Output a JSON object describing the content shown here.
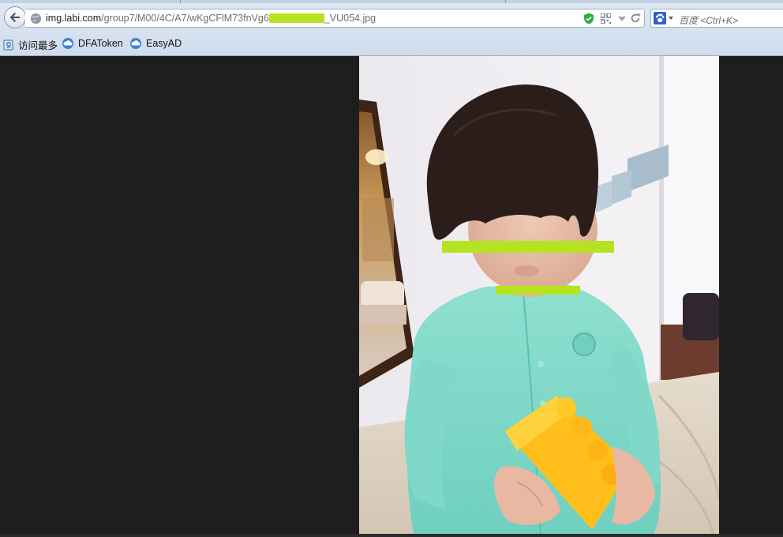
{
  "browser": {
    "url": {
      "host": "img.labi.com",
      "path_start": "/group7/M00/4C/A7/wKgCFlM73fnVg6",
      "path_end": "_VU054.jpg"
    },
    "search": {
      "engine_icon": "paw-icon",
      "placeholder": "百度 <Ctrl+K>"
    },
    "bookmarks": [
      {
        "label": "访问最多",
        "icon": "bookmark-folder-icon"
      },
      {
        "label": "DFAToken",
        "icon": "cloud-icon"
      },
      {
        "label": "EasyAD",
        "icon": "cloud-icon"
      }
    ]
  },
  "viewer": {
    "background_color": "#1e1e1e",
    "redaction_color": "#b6e31f"
  }
}
